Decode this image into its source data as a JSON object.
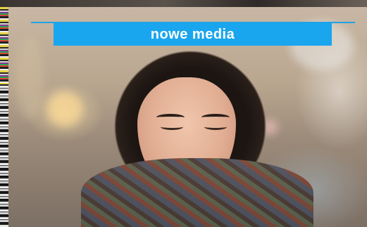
{
  "header": {
    "title": "nowe media"
  },
  "colors": {
    "accent": "#1aa6ee",
    "title_text": "#ffffff"
  }
}
